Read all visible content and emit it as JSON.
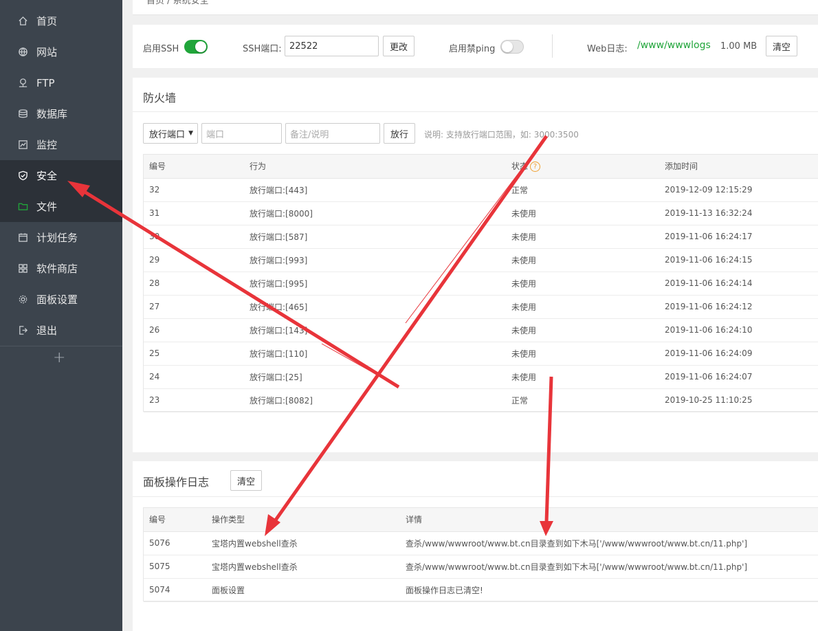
{
  "sidebar": {
    "items": [
      {
        "label": "首页",
        "icon": "home-icon"
      },
      {
        "label": "网站",
        "icon": "globe-icon"
      },
      {
        "label": "FTP",
        "icon": "ftp-icon"
      },
      {
        "label": "数据库",
        "icon": "database-icon"
      },
      {
        "label": "监控",
        "icon": "monitor-icon"
      },
      {
        "label": "安全",
        "icon": "shield-icon"
      },
      {
        "label": "文件",
        "icon": "folder-icon"
      },
      {
        "label": "计划任务",
        "icon": "calendar-icon"
      },
      {
        "label": "软件商店",
        "icon": "grid-icon"
      },
      {
        "label": "面板设置",
        "icon": "gear-icon"
      },
      {
        "label": "退出",
        "icon": "logout-icon"
      }
    ],
    "add_label": "+"
  },
  "breadcrumb": "首页  /  系统安全",
  "ssh": {
    "enable_label": "启用SSH",
    "port_label": "SSH端口:",
    "port_value": "22522",
    "change_button": "更改",
    "ping_label": "启用禁ping",
    "weblog_label": "Web日志:",
    "weblog_path": "/www/wwwlogs",
    "weblog_size": "1.00 MB",
    "clear_button": "清空"
  },
  "firewall": {
    "title": "防火墙",
    "select_value": "放行端口",
    "port_placeholder": "端口",
    "note_placeholder": "备注/说明",
    "allow_button": "放行",
    "hint": "说明: 支持放行端口范围，如: 3000:3500",
    "columns": [
      "编号",
      "行为",
      "状态",
      "添加时间"
    ],
    "rows": [
      [
        "32",
        "放行端口:[443]",
        "正常",
        "2019-12-09 12:15:29"
      ],
      [
        "31",
        "放行端口:[8000]",
        "未使用",
        "2019-11-13 16:32:24"
      ],
      [
        "30",
        "放行端口:[587]",
        "未使用",
        "2019-11-06 16:24:17"
      ],
      [
        "29",
        "放行端口:[993]",
        "未使用",
        "2019-11-06 16:24:15"
      ],
      [
        "28",
        "放行端口:[995]",
        "未使用",
        "2019-11-06 16:24:14"
      ],
      [
        "27",
        "放行端口:[465]",
        "未使用",
        "2019-11-06 16:24:12"
      ],
      [
        "26",
        "放行端口:[143]",
        "未使用",
        "2019-11-06 16:24:10"
      ],
      [
        "25",
        "放行端口:[110]",
        "未使用",
        "2019-11-06 16:24:09"
      ],
      [
        "24",
        "放行端口:[25]",
        "未使用",
        "2019-11-06 16:24:07"
      ],
      [
        "23",
        "放行端口:[8082]",
        "正常",
        "2019-10-25 11:10:25"
      ]
    ]
  },
  "panel_log": {
    "title": "面板操作日志",
    "clear_button": "清空",
    "columns": [
      "编号",
      "操作类型",
      "详情"
    ],
    "rows": [
      [
        "5076",
        "宝塔内置webshell查杀",
        "查杀/www/wwwroot/www.bt.cn目录查到如下木马['/www/wwwroot/www.bt.cn/11.php']"
      ],
      [
        "5075",
        "宝塔内置webshell查杀",
        "查杀/www/wwwroot/www.bt.cn目录查到如下木马['/www/wwwroot/www.bt.cn/11.php']"
      ],
      [
        "5074",
        "面板设置",
        "面板操作日志已清空!"
      ]
    ]
  },
  "colors": {
    "accent": "#20a53a",
    "arrow": "#e8343a",
    "sidebar": "#3c444d",
    "sidebar_active": "#2c3138"
  }
}
